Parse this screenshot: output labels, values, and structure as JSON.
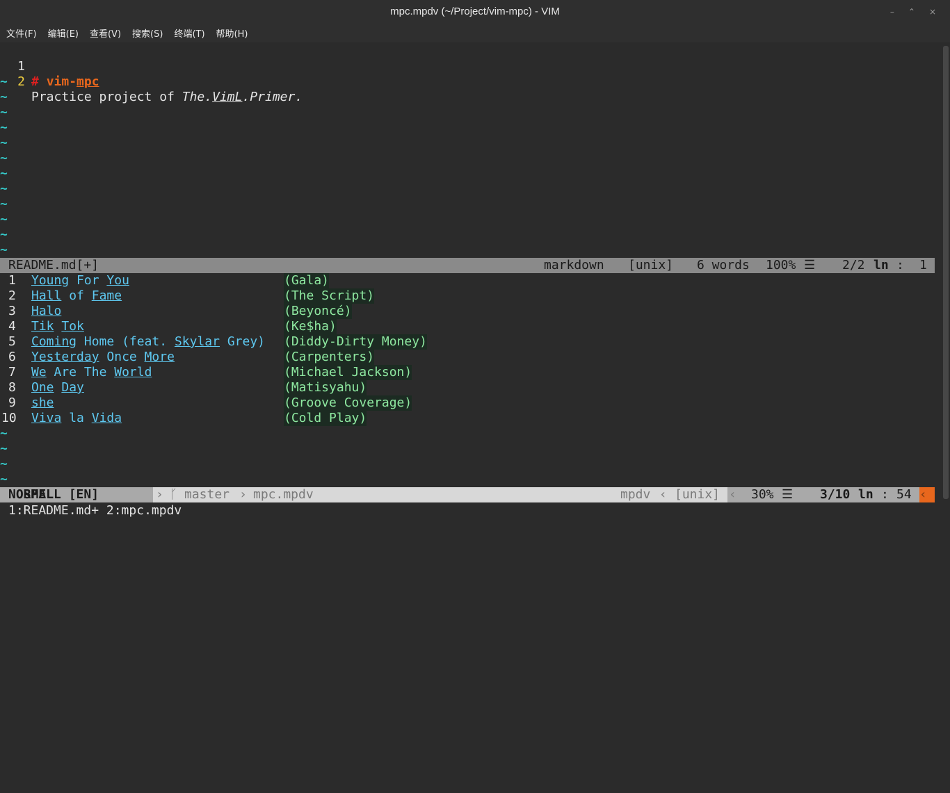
{
  "window": {
    "title": "mpc.mpdv (~/Project/vim-mpc) - VIM",
    "controls": [
      "–",
      "⌃",
      "×"
    ]
  },
  "menu": [
    "文件(F)",
    "编辑(E)",
    "查看(V)",
    "搜索(S)",
    "终端(T)",
    "帮助(H)"
  ],
  "top_buffer": {
    "lines": [
      {
        "num": "1",
        "hash": "#",
        "text_a": "vim-",
        "text_b": "mpc"
      },
      {
        "num": "2",
        "plain": "Practice project of ",
        "it1": "The.",
        "it2": "VimL",
        "it3": ".Primer."
      }
    ],
    "tilde": "~"
  },
  "status_top": {
    "filename": "README.md[+]",
    "filetype": "markdown",
    "format": "[unix]",
    "words": "6 words",
    "percent": "100%",
    "icon": "☰",
    "position": "2/2",
    "ln": "ln",
    "colon": ":",
    "col": "1"
  },
  "playlist": [
    {
      "num": "1",
      "title": "Young For You",
      "artist": "(Gala)"
    },
    {
      "num": "2",
      "title": "Hall of Fame",
      "artist": "(The Script)"
    },
    {
      "num": "3",
      "title": "Halo",
      "artist": "(Beyoncé)"
    },
    {
      "num": "4",
      "title": "Tik Tok",
      "artist": "(Ke$ha)"
    },
    {
      "num": "5",
      "title": "Coming Home (feat. Skylar Grey)",
      "artist": "(Diddy-Dirty Money)"
    },
    {
      "num": "6",
      "title": "Yesterday Once More",
      "artist": "(Carpenters)"
    },
    {
      "num": "7",
      "title": "We Are The World",
      "artist": "(Michael Jackson)"
    },
    {
      "num": "8",
      "title": "One Day",
      "artist": "(Matisyahu)"
    },
    {
      "num": "9",
      "title": "she",
      "artist": "(Groove Coverage)"
    },
    {
      "num": "10",
      "title": "Viva la Vida",
      "artist": "(Cold Play)"
    }
  ],
  "status_bottom": {
    "mode": "NORMAL",
    "spell": "SPELL [EN]",
    "sep": "›",
    "branch_icon": "ᚴ",
    "branch": "master",
    "file": "mpc.mpdv",
    "filetype": "mpdv",
    "lsep": "‹",
    "format": "[unix]",
    "percent": "30%",
    "icon": "☰",
    "position": "3/10",
    "ln": "ln",
    "colon": ":",
    "col": "54"
  },
  "cmdline": "1:README.md+ 2:mpc.mpdv"
}
